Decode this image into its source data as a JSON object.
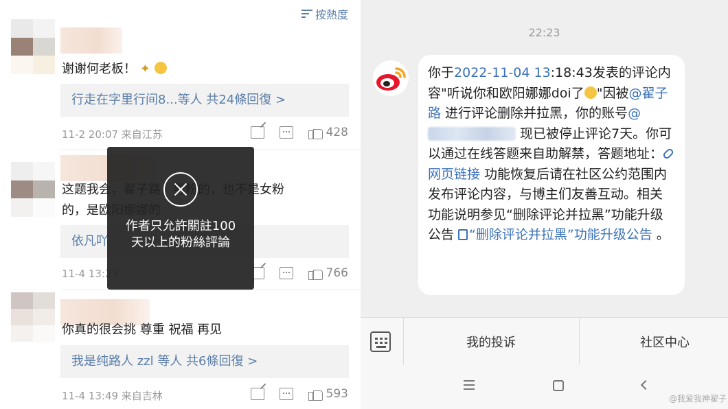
{
  "left": {
    "sort_label": "按熱度",
    "comments": [
      {
        "text": "谢谢何老板！",
        "replies": "行走在字里行间8...等人 共24條回復 >",
        "meta": "11-2 20:07 来自江苏",
        "likes": "428"
      },
      {
        "text_line1": "这题我会，翟子路，男粉的，也不是女粉",
        "text_line2": "的，是欧阳娜娜的",
        "replies": "依凡吖",
        "meta": "11-4 13:23",
        "likes": "766"
      },
      {
        "text": "你真的很会挑 尊重 祝福 再见",
        "replies": "我是纯路人 zzl 等人 共6條回復 >",
        "meta": "11-4 13:49 来自吉林",
        "likes": "593"
      }
    ],
    "toast": {
      "line1": "作者只允許關註100",
      "line2": "天以上的粉絲評論"
    }
  },
  "right": {
    "time": "22:23",
    "message": {
      "p1": "你于",
      "date": "2022-11-04 13",
      "p2": ":18:43发表的评论内容\"听说你和欧阳娜娜doi了",
      "p3": "\"因被",
      "mention": "@翟子路",
      "p4": " 进行评论删除并拉黑，你的账号",
      "account_prefix": "@",
      "p5": " 现已被停止评论7天。你可以通过在线答题来自助解禁，答题地址：",
      "link": "网页链接",
      "p6": " 功能恢复后请在社区公约范围内发布评论内容，与博主们友善互动。相关功能说明参见“删除评论并拉黑”功能升级公告 ",
      "notice_link": "“删除评论并拉黑”功能升级公告",
      "p7": " 。"
    },
    "tabs": [
      "我的投诉",
      "社区中心"
    ],
    "watermark": "@我爱我神翟子"
  },
  "colors": {
    "link_blue": "#3b72b8",
    "weibo_red": "#e6162d",
    "weibo_orange": "#f5a623"
  }
}
